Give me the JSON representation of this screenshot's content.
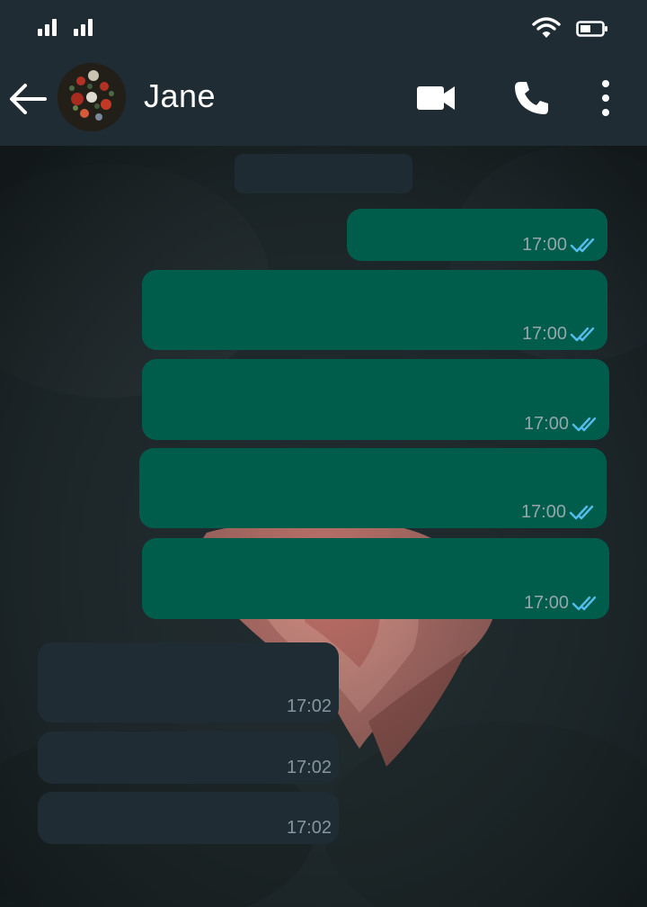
{
  "contact": {
    "name": "Jane"
  },
  "colors": {
    "header": "#1f2c34",
    "outgoing_bubble": "#005c4b",
    "incoming_bubble": "#1f2c34",
    "read_ticks": "#53bdeb"
  },
  "icons": {
    "back": "arrow-left-icon",
    "video": "video-camera-icon",
    "call": "phone-icon",
    "menu": "more-vertical-icon",
    "status": [
      "signal-icon",
      "signal-icon",
      "wifi-icon",
      "battery-icon"
    ]
  },
  "messages": [
    {
      "direction": "out",
      "time": "17:00",
      "status": "read"
    },
    {
      "direction": "out",
      "time": "17:00",
      "status": "read"
    },
    {
      "direction": "out",
      "time": "17:00",
      "status": "read"
    },
    {
      "direction": "out",
      "time": "17:00",
      "status": "read"
    },
    {
      "direction": "out",
      "time": "17:00",
      "status": "read"
    },
    {
      "direction": "in",
      "time": "17:02"
    },
    {
      "direction": "in",
      "time": "17:02"
    },
    {
      "direction": "in",
      "time": "17:02"
    }
  ]
}
